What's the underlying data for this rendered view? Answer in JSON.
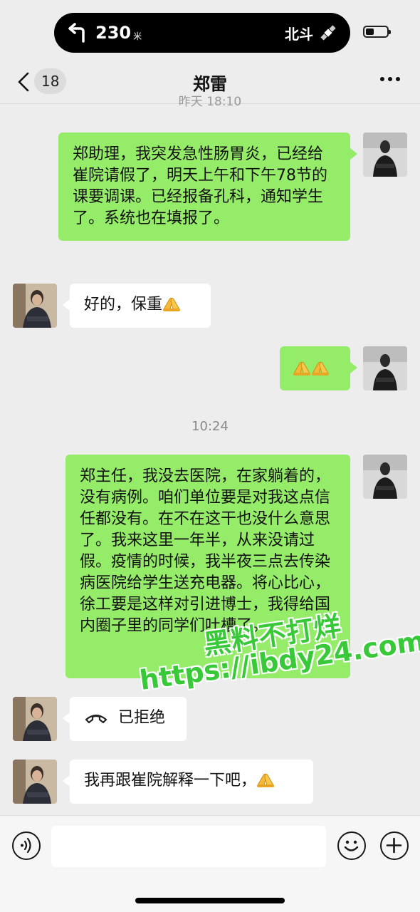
{
  "status_bar": {
    "navigation_distance": "230",
    "navigation_unit": "米",
    "navigation_system": "北斗",
    "turn_icon": "turn-left-icon",
    "satellite_icon": "satellite-icon"
  },
  "header": {
    "unread_count": "18",
    "title": "郑雷",
    "back_icon": "chevron-left-icon",
    "more_icon": "more-dots-icon"
  },
  "clipped_timestamp": "昨天 18:10",
  "messages": [
    {
      "side": "right",
      "text": "郑助理，我突发急性肠胃炎，已经给崔院请假了，明天上午和下午78节的课要调课。已经报备孔科，通知学生了。系统也在填报了。"
    },
    {
      "side": "left",
      "text": "好的，保重",
      "emoji": "folded-hands-emoji"
    },
    {
      "side": "right",
      "text": "",
      "emoji": "folded-hands-emoji x2"
    },
    {
      "side": "center",
      "text": "10:24"
    },
    {
      "side": "right",
      "text": "郑主任，我没去医院，在家躺着的，没有病例。咱们单位要是对我这点信任都没有。在不在这干也没什么意思了。我来这里一年半，从来没请过假。疫情的时候，我半夜三点去传染病医院给学生送充电器。将心比心，徐工要是这样对引进博士，我得给国内圈子里的同学们吐槽了。"
    },
    {
      "side": "left",
      "text": "已拒绝",
      "icon": "phone-call-icon"
    },
    {
      "side": "left",
      "text": "我再跟崔院解释一下吧，",
      "emoji": "folded-hands-emoji"
    }
  ],
  "watermark": {
    "line1": "黑料不打烊",
    "line2": "https://ibdy24.com"
  },
  "input_bar": {
    "voice_icon": "voice-icon",
    "emoji_icon": "emoji-icon",
    "plus_icon": "plus-icon",
    "placeholder": ""
  },
  "colors": {
    "sent_bubble": "#95ec69",
    "received_bubble": "#ffffff",
    "background": "#ededed",
    "watermark": "#37c937"
  }
}
